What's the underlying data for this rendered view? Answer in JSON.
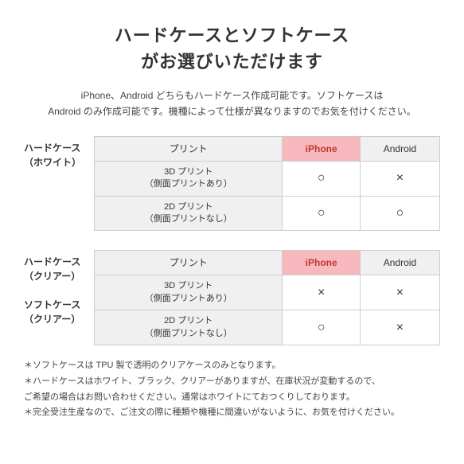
{
  "page": {
    "main_title_line1": "ハードケースとソフトケース",
    "main_title_line2": "がお選びいただけます",
    "subtitle": "iPhone、Android どちらもハードケース作成可能です。ソフトケースは\nAndroid のみ作成可能です。機種によって仕様が異なりますのでお気を付けください。",
    "table1": {
      "section_label_line1": "ハードケース",
      "section_label_line2": "（ホワイト）",
      "header": {
        "col1": "プリント",
        "col2": "iPhone",
        "col3": "Android"
      },
      "rows": [
        {
          "label_line1": "3D プリント",
          "label_line2": "（側面プリントあり）",
          "iphone": "○",
          "android": "×"
        },
        {
          "label_line1": "2D プリント",
          "label_line2": "（側面プリントなし）",
          "iphone": "○",
          "android": "○"
        }
      ]
    },
    "table2": {
      "section_label_line1": "ハードケース",
      "section_label_line2": "（クリアー）",
      "section_label2_line1": "ソフトケース",
      "section_label2_line2": "（クリアー）",
      "header": {
        "col1": "プリント",
        "col2": "iPhone",
        "col3": "Android"
      },
      "rows": [
        {
          "label_line1": "3D プリント",
          "label_line2": "（側面プリントあり）",
          "iphone": "×",
          "android": "×"
        },
        {
          "label_line1": "2D プリント",
          "label_line2": "（側面プリントなし）",
          "iphone": "○",
          "android": "×"
        }
      ]
    },
    "notes": [
      "ソフトケースは TPU 製で透明のクリアケースのみとなります。",
      "ハードケースはホワイト、ブラック、クリアーがありますが、在庫状況が変動するので、\nご希望の場合はお問い合わせください。通常はホワイトにておつくりしております。",
      "完全受注生産なので、ご注文の際に種類や機種に間違いがないように、お気を付けください。"
    ]
  }
}
